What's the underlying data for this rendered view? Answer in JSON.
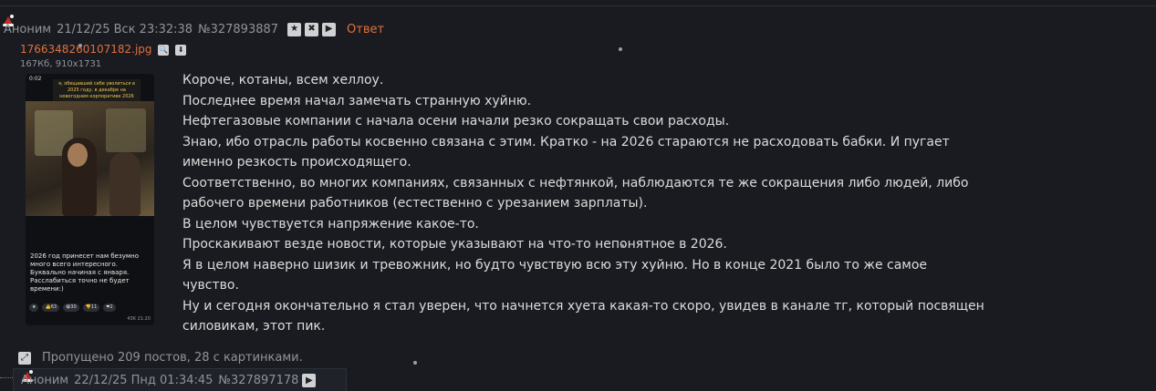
{
  "post": {
    "name": "Аноним",
    "date": "21/12/25 Вск 23:32:38",
    "number": "№327893887",
    "buttons": [
      "★",
      "✖",
      "▶"
    ],
    "reply_label": "Ответ",
    "file": {
      "name": "1766348260107182.jpg",
      "meta": "167Кб, 910x1731",
      "thumb": {
        "time": "0:02",
        "caption": "я, обещавший себе уволиться в 2025 году, в декабре на новогоднем корпоративе 2026",
        "text": "2026 год принесет нам безумно много всего интересного. Буквально начиная с января. Расслабиться точно не будет времени:)",
        "reactions": [
          "★",
          "👍63",
          "😁30",
          "👎11",
          "❤2"
        ],
        "views": "43K 21:20"
      }
    },
    "lines": [
      "Короче, котаны, всем хеллоу.",
      "Последнее время начал замечать странную хуйню.",
      "Нефтегазовые компании с начала осени начали резко сокращать свои расходы.",
      "Знаю, ибо отрасль работы косвенно связана с этим. Кратко - на 2026 стараются не расходовать бабки. И пугает",
      "именно резкость происходящего.",
      "Соответственно, во многих компаниях, связанных с нефтянкой, наблюдаются те же сокращения либо людей, либо",
      "рабочего времени работников (естественно с урезанием зарплаты).",
      "В целом чувствуется напряжение какое-то.",
      "Проскакивают везде новости, которые указывают на что-то непонятное в 2026.",
      "Я в целом наверно шизик и тревожник, но будто чувствую всю эту хуйню. Но в конце 2021 было то же самое",
      "чувство.",
      "Ну и сегодня окончательно я стал уверен, что начнется хуета какая-то скоро, увидев в канале тг, который посвящен",
      "силовикам, этот пик."
    ]
  },
  "omitted": "Пропущено 209 постов, 28 с картинками.",
  "post2": {
    "name": "Аноним",
    "date": "22/12/25 Пнд 01:34:45",
    "number": "№327897178"
  }
}
